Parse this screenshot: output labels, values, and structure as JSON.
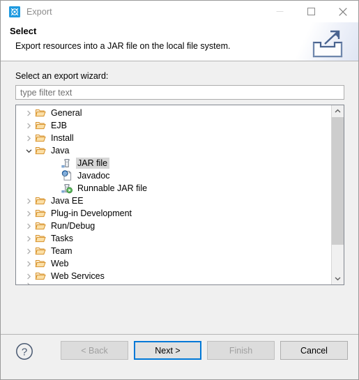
{
  "window": {
    "title": "Export",
    "icon": "eclipse-export-icon",
    "controls": [
      {
        "name": "minimize",
        "glyph": "minimize-icon",
        "enabled": false
      },
      {
        "name": "maximize",
        "glyph": "maximize-icon",
        "enabled": true
      },
      {
        "name": "close",
        "glyph": "close-icon",
        "enabled": true
      }
    ]
  },
  "header": {
    "title": "Select",
    "description": "Export resources into a JAR file on the local file system.",
    "graphic": "export-arrow-tray-icon"
  },
  "body": {
    "wizard_label": "Select an export wizard:",
    "filter": {
      "value": "",
      "placeholder": "type filter text"
    }
  },
  "tree": {
    "rows": [
      {
        "label": "General",
        "depth": 0,
        "icon": "folder-icon",
        "twisty": "chevron-right",
        "selected": false
      },
      {
        "label": "EJB",
        "depth": 0,
        "icon": "folder-icon",
        "twisty": "chevron-right",
        "selected": false
      },
      {
        "label": "Install",
        "depth": 0,
        "icon": "folder-icon",
        "twisty": "chevron-right",
        "selected": false
      },
      {
        "label": "Java",
        "depth": 0,
        "icon": "folder-icon",
        "twisty": "chevron-down",
        "selected": false
      },
      {
        "label": "JAR file",
        "depth": 1,
        "icon": "jar-file-icon",
        "twisty": "none",
        "selected": true
      },
      {
        "label": "Javadoc",
        "depth": 1,
        "icon": "javadoc-icon",
        "twisty": "none",
        "selected": false
      },
      {
        "label": "Runnable JAR file",
        "depth": 1,
        "icon": "runnable-jar-icon",
        "twisty": "none",
        "selected": false
      },
      {
        "label": "Java EE",
        "depth": 0,
        "icon": "folder-icon",
        "twisty": "chevron-right",
        "selected": false
      },
      {
        "label": "Plug-in Development",
        "depth": 0,
        "icon": "folder-icon",
        "twisty": "chevron-right",
        "selected": false
      },
      {
        "label": "Run/Debug",
        "depth": 0,
        "icon": "folder-icon",
        "twisty": "chevron-right",
        "selected": false
      },
      {
        "label": "Tasks",
        "depth": 0,
        "icon": "folder-icon",
        "twisty": "chevron-right",
        "selected": false
      },
      {
        "label": "Team",
        "depth": 0,
        "icon": "folder-icon",
        "twisty": "chevron-right",
        "selected": false
      },
      {
        "label": "Web",
        "depth": 0,
        "icon": "folder-icon",
        "twisty": "chevron-right",
        "selected": false
      },
      {
        "label": "Web Services",
        "depth": 0,
        "icon": "folder-icon",
        "twisty": "chevron-right",
        "selected": false
      },
      {
        "label": "XML",
        "depth": 0,
        "icon": "folder-icon",
        "twisty": "chevron-right",
        "selected": false,
        "clipped": true
      }
    ],
    "scrollbar": {
      "up_arrow": "scroll-up-icon",
      "down_arrow": "scroll-down-icon"
    }
  },
  "footer": {
    "help": "help-icon",
    "buttons": [
      {
        "label": "< Back",
        "enabled": false,
        "focused": false
      },
      {
        "label": "Next >",
        "enabled": true,
        "focused": true
      },
      {
        "label": "Finish",
        "enabled": false,
        "focused": false
      },
      {
        "label": "Cancel",
        "enabled": true,
        "focused": false
      }
    ]
  },
  "colors": {
    "accent": "#0078d7",
    "dialog_bg": "#f0f0f0",
    "selection": "#d6d6d6",
    "folder": "#e8a33d",
    "help": "#4a5a72"
  }
}
